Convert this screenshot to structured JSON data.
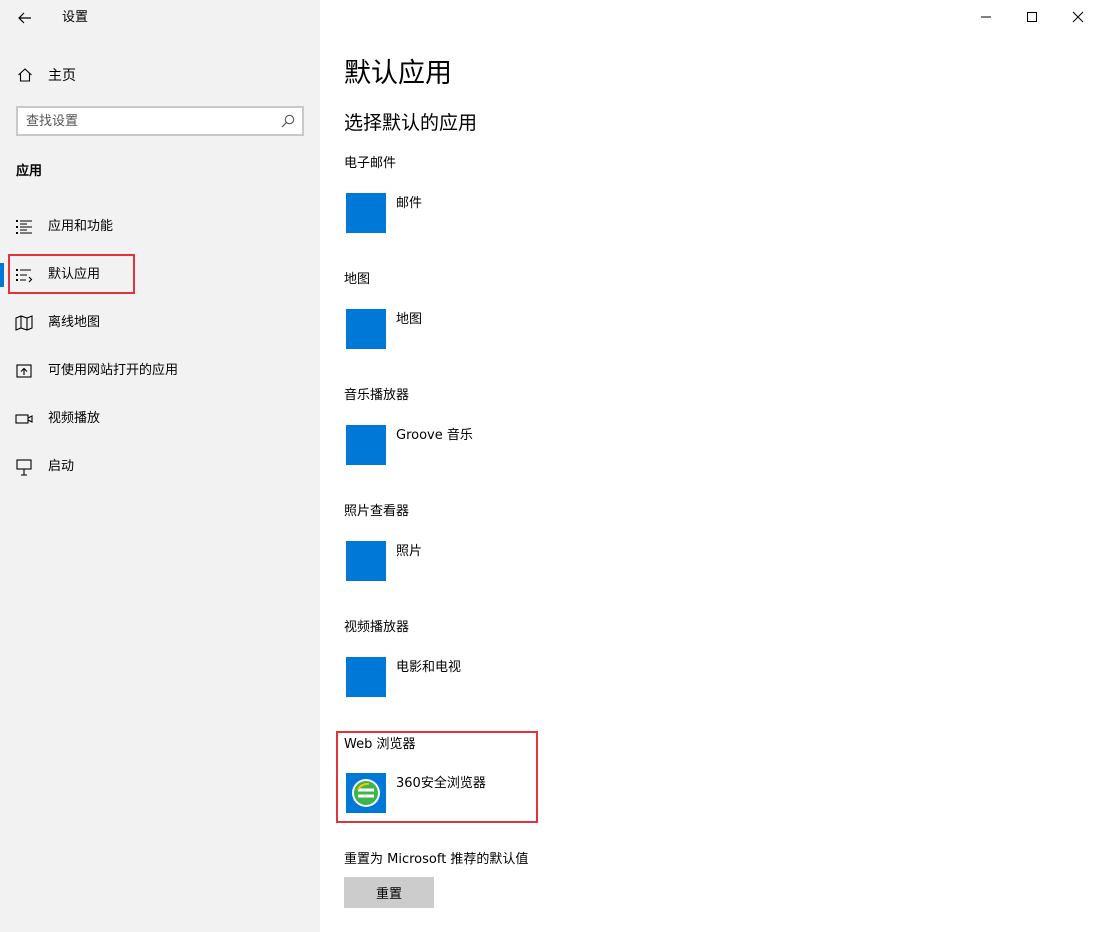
{
  "window": {
    "title": "设置",
    "back_icon": "back-arrow-icon",
    "minimize_icon": "minimize-icon",
    "maximize_icon": "maximize-icon",
    "close_icon": "close-icon"
  },
  "sidebar": {
    "home_label": "主页",
    "search_placeholder": "查找设置",
    "section_heading": "应用",
    "items": [
      {
        "label": "应用和功能",
        "icon": "apps-features-icon"
      },
      {
        "label": "默认应用",
        "icon": "default-apps-icon",
        "active": true
      },
      {
        "label": "离线地图",
        "icon": "offline-maps-icon"
      },
      {
        "label": "可使用网站打开的应用",
        "icon": "apps-for-websites-icon"
      },
      {
        "label": "视频播放",
        "icon": "video-playback-icon"
      },
      {
        "label": "启动",
        "icon": "startup-icon"
      }
    ]
  },
  "main": {
    "title": "默认应用",
    "subtitle": "选择默认的应用",
    "categories": [
      {
        "label": "电子邮件",
        "app": "邮件"
      },
      {
        "label": "地图",
        "app": "地图"
      },
      {
        "label": "音乐播放器",
        "app": "Groove 音乐"
      },
      {
        "label": "照片查看器",
        "app": "照片"
      },
      {
        "label": "视频播放器",
        "app": "电影和电视"
      },
      {
        "label": "Web 浏览器",
        "app": "360安全浏览器"
      }
    ],
    "reset_label": "重置为 Microsoft 推荐的默认值",
    "reset_button": "重置"
  },
  "colors": {
    "accent": "#0078d7",
    "highlight_box": "#e0333a",
    "sidebar_bg": "#f2f2f2",
    "button_bg": "#cccccc"
  }
}
